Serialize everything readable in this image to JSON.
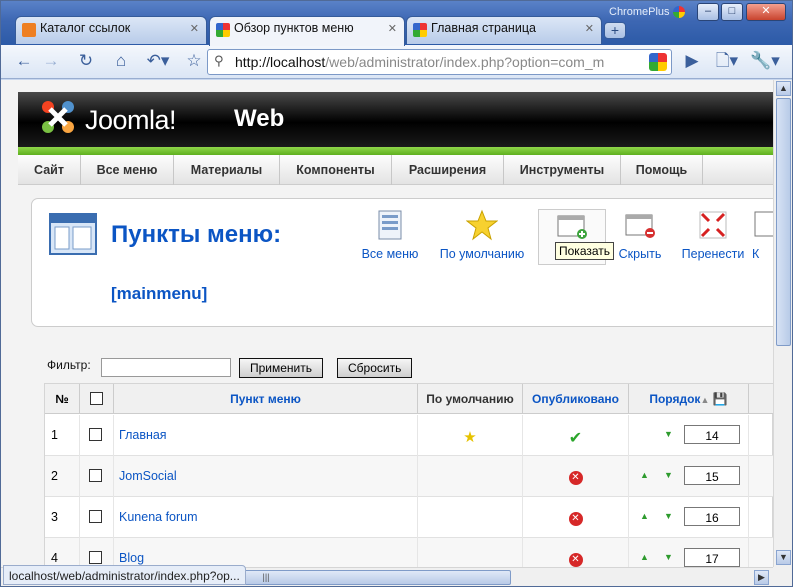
{
  "browser": {
    "brand": "ChromePlus",
    "tabs": [
      {
        "title": "Каталог ссылок",
        "active": false
      },
      {
        "title": "Обзор пунктов меню",
        "active": true
      },
      {
        "title": "Главная страница",
        "active": false
      }
    ],
    "url_host": "http://localhost",
    "url_path": "/web/administrator/index.php?option=com_m",
    "status_url": "localhost/web/administrator/index.php?op...",
    "window_buttons": {
      "minimize": "–",
      "maximize": "□",
      "close": "✕"
    }
  },
  "joomla": {
    "logo_text": "Joomla!",
    "site_name": "Web",
    "menu": [
      "Сайт",
      "Все меню",
      "Материалы",
      "Компоненты",
      "Расширения",
      "Инструменты",
      "Помощь"
    ],
    "page_title": "Пункты меню:",
    "page_subtitle": "[mainmenu]",
    "toolbar": [
      {
        "label": "Все меню",
        "icon": "menus-icon"
      },
      {
        "label": "По умолчанию",
        "icon": "star-icon"
      },
      {
        "label": "По",
        "icon": "publish-icon"
      },
      {
        "label": "Скрыть",
        "icon": "unpublish-icon"
      },
      {
        "label": "Перенести",
        "icon": "move-icon"
      },
      {
        "label": "К",
        "icon": "copy-icon"
      }
    ],
    "tooltip": "Показать",
    "filter": {
      "label": "Фильтр:",
      "value": "",
      "apply": "Применить",
      "reset": "Сбросить"
    },
    "table": {
      "headers": [
        "№",
        "",
        "Пункт меню",
        "По умолчанию",
        "Опубликовано",
        "Порядок"
      ],
      "rows": [
        {
          "num": "1",
          "title": "Главная",
          "default": true,
          "published": true,
          "up": false,
          "down": true,
          "order": "14"
        },
        {
          "num": "2",
          "title": "JomSocial",
          "default": false,
          "published": false,
          "up": true,
          "down": true,
          "order": "15"
        },
        {
          "num": "3",
          "title": "Kunena forum",
          "default": false,
          "published": false,
          "up": true,
          "down": true,
          "order": "16"
        },
        {
          "num": "4",
          "title": "Blog",
          "default": false,
          "published": false,
          "up": true,
          "down": true,
          "order": "17"
        }
      ]
    }
  },
  "colors": {
    "link": "#0b55c4",
    "header_green": "#6fc02a",
    "chrome_blue": "#3d67b3"
  }
}
